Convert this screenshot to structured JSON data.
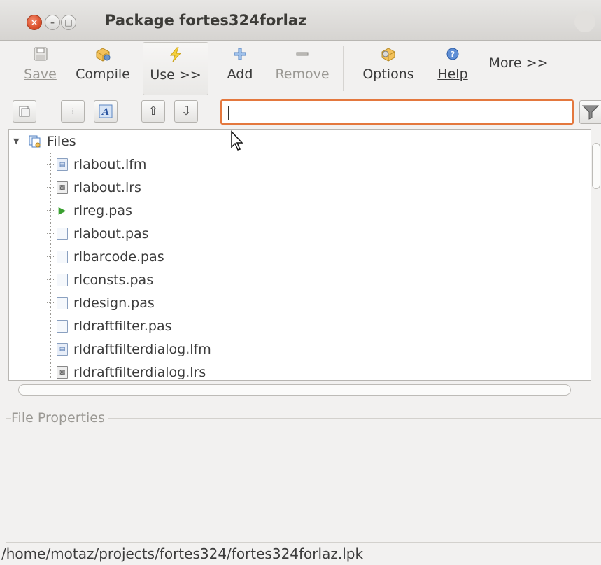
{
  "window": {
    "title": "Package fortes324forlaz",
    "close_glyph": "×",
    "min_glyph": "–",
    "max_glyph": "□"
  },
  "toolbar": {
    "save_label": "Save",
    "compile_label": "Compile",
    "use_label": "Use >>",
    "add_label": "Add",
    "remove_label": "Remove",
    "options_label": "Options",
    "help_label": "Help",
    "more_label": "More >>"
  },
  "filter": {
    "value": ""
  },
  "tree": {
    "root_label": "Files",
    "items": [
      {
        "name": "rlabout.lfm",
        "icon": "form-icon"
      },
      {
        "name": "rlabout.lrs",
        "icon": "resource-icon"
      },
      {
        "name": "rlreg.pas",
        "icon": "register-icon"
      },
      {
        "name": "rlabout.pas",
        "icon": "unit-icon"
      },
      {
        "name": "rlbarcode.pas",
        "icon": "unit-icon"
      },
      {
        "name": "rlconsts.pas",
        "icon": "unit-icon"
      },
      {
        "name": "rldesign.pas",
        "icon": "unit-icon"
      },
      {
        "name": "rldraftfilter.pas",
        "icon": "unit-icon"
      },
      {
        "name": "rldraftfilterdialog.lfm",
        "icon": "form-icon"
      },
      {
        "name": "rldraftfilterdialog.lrs",
        "icon": "resource-icon"
      }
    ]
  },
  "properties": {
    "label": "File Properties"
  },
  "status": {
    "path": "/home/motaz/projects/fortes324/fortes324forlaz.lpk"
  },
  "colors": {
    "accent": "#e4783e",
    "close_button": "#d84a25"
  }
}
